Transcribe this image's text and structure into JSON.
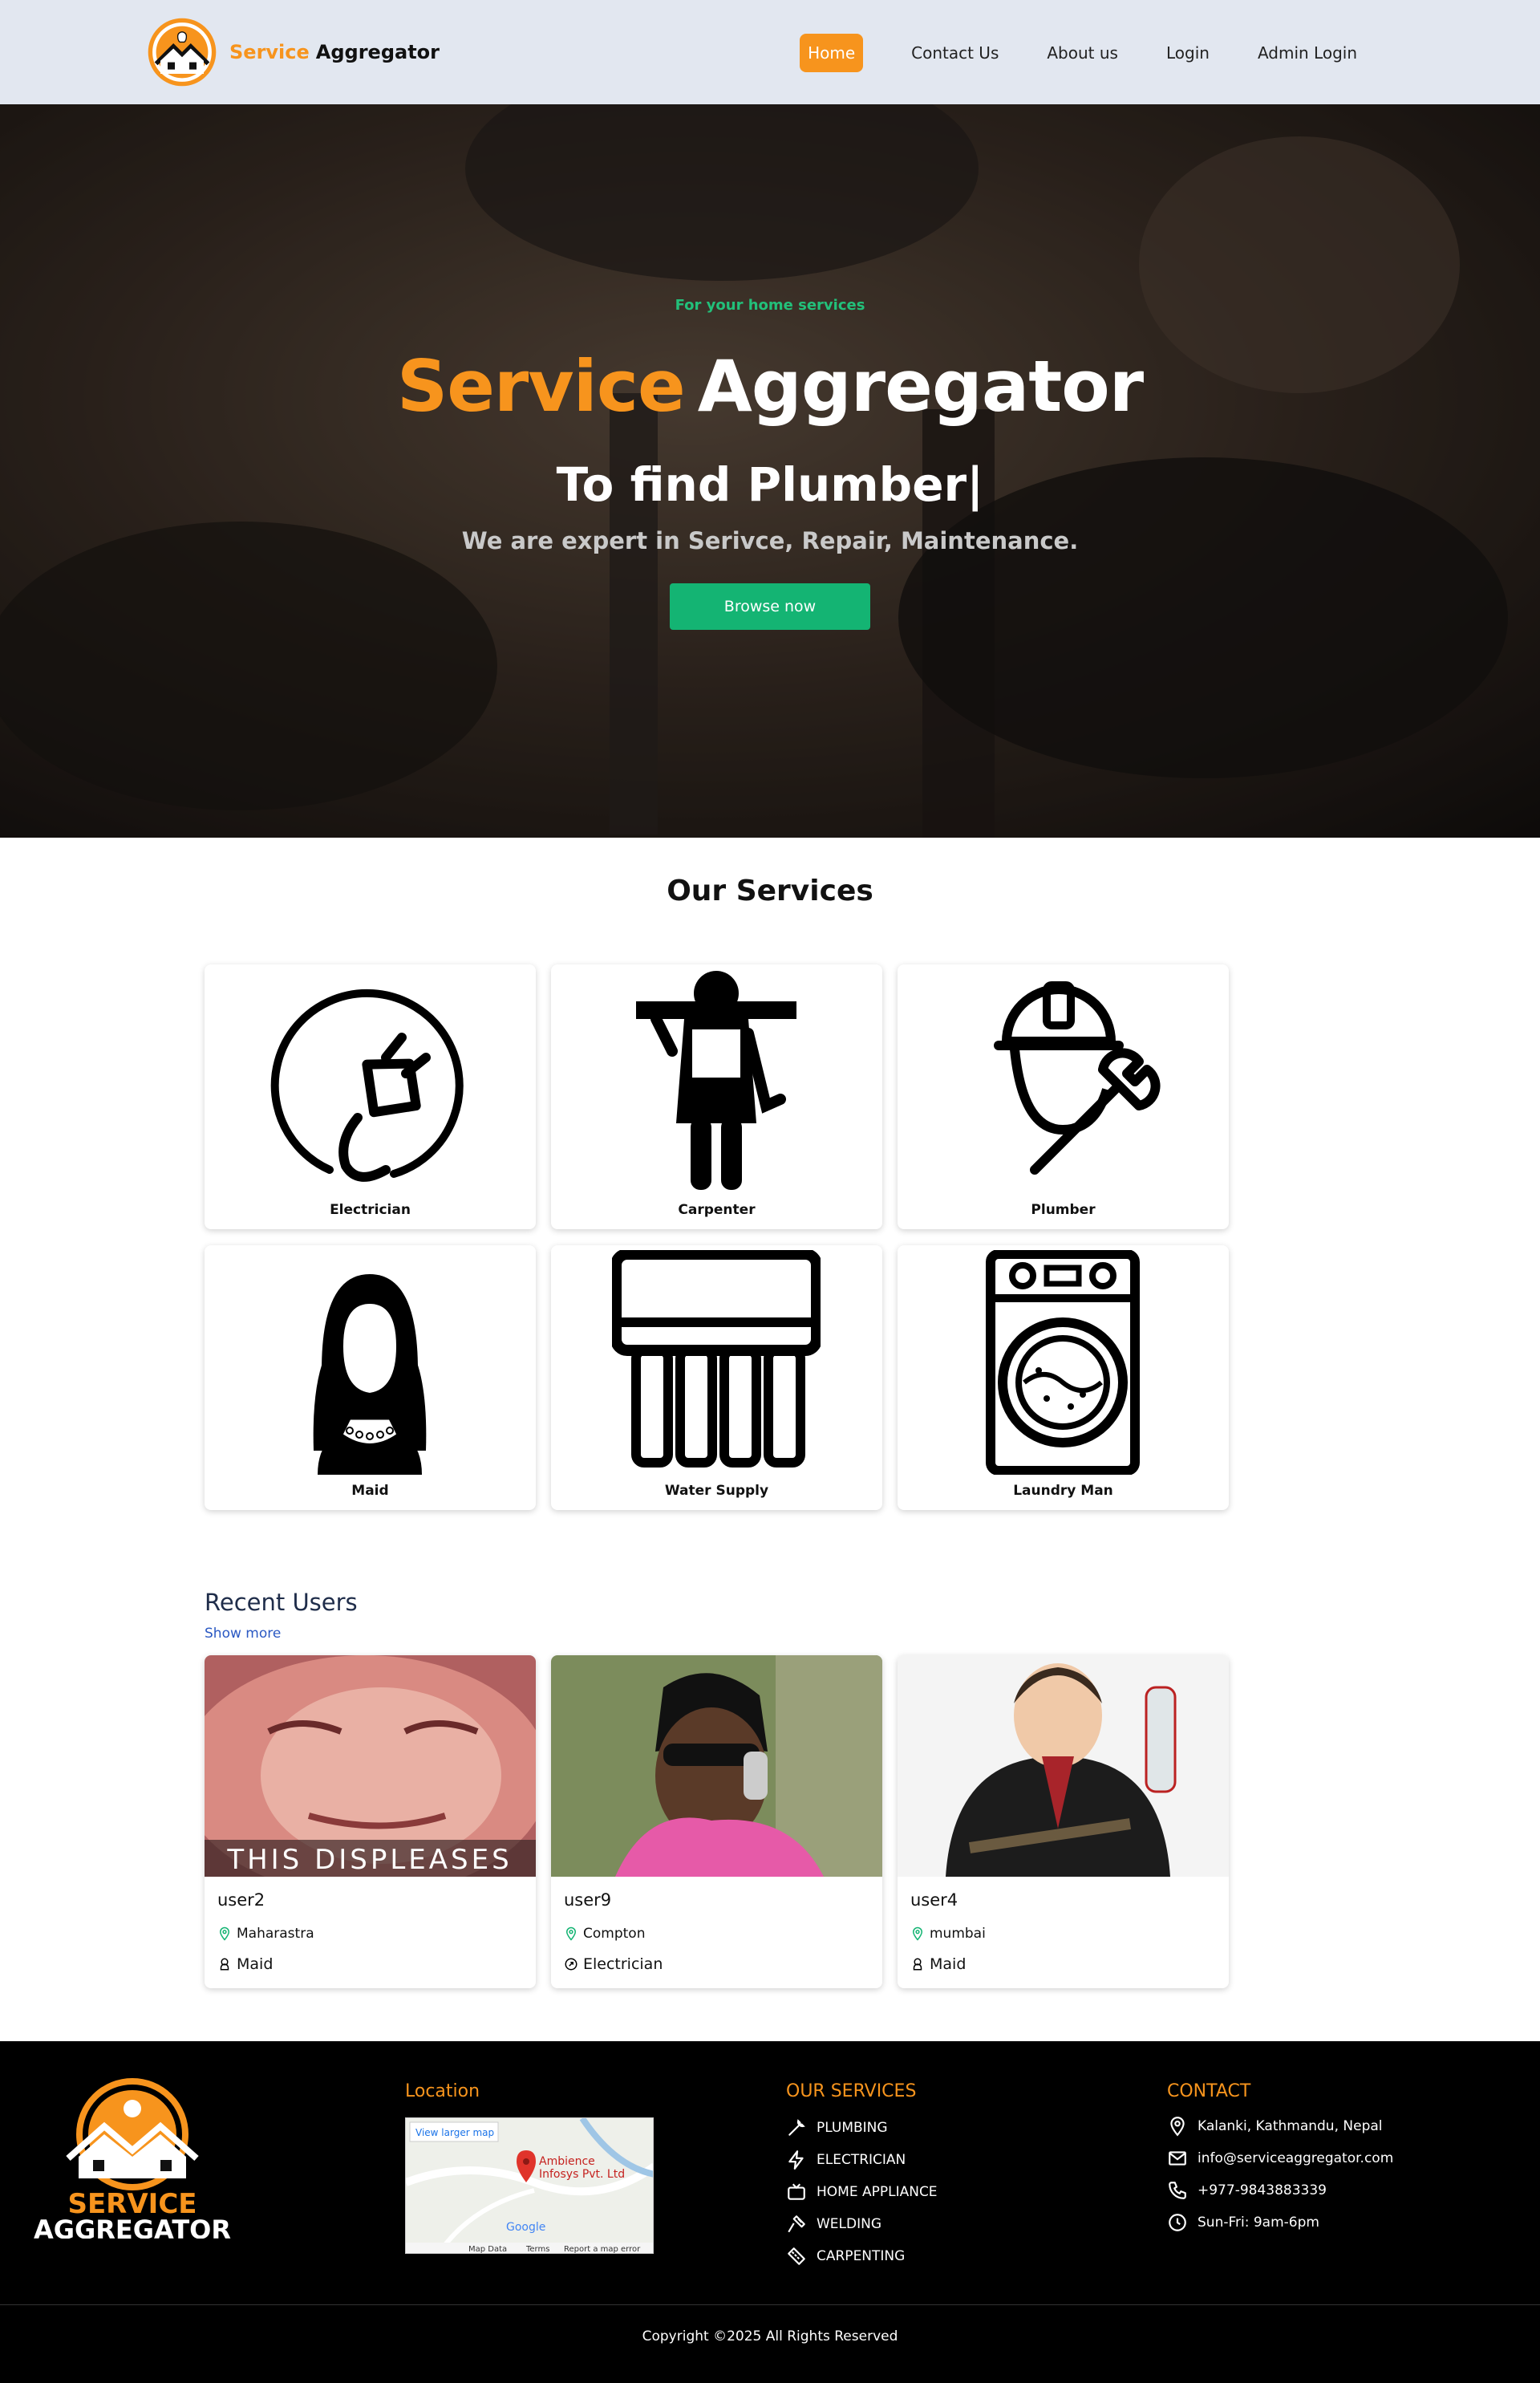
{
  "brand": {
    "name_accent": "Service",
    "name_rest": "Aggregator"
  },
  "nav": {
    "items": [
      {
        "label": "Home",
        "active": true
      },
      {
        "label": "Contact Us"
      },
      {
        "label": "About us"
      },
      {
        "label": "Login"
      },
      {
        "label": "Admin Login"
      }
    ]
  },
  "hero": {
    "tagline": "For your home services",
    "title_accent": "Service",
    "title_rest": "Aggregator",
    "subtitle": "To find Plumber|",
    "description": "We are expert in Serivce, Repair, Maintenance.",
    "button": "Browse now"
  },
  "services": {
    "title": "Our Services",
    "items": [
      {
        "label": "Electrician",
        "icon": "plug-icon"
      },
      {
        "label": "Carpenter",
        "icon": "carpenter-icon"
      },
      {
        "label": "Plumber",
        "icon": "plumber-icon"
      },
      {
        "label": "Maid",
        "icon": "maid-icon"
      },
      {
        "label": "Water Supply",
        "icon": "water-supply-icon"
      },
      {
        "label": "Laundry Man",
        "icon": "washing-machine-icon"
      }
    ]
  },
  "recent_users": {
    "title": "Recent Users",
    "show_more": "Show more",
    "users": [
      {
        "name": "user2",
        "location": "Maharastra",
        "role": "Maid",
        "image_caption": "THIS DISPLEASES"
      },
      {
        "name": "user9",
        "location": "Compton",
        "role": "Electrician"
      },
      {
        "name": "user4",
        "location": "mumbai",
        "role": "Maid"
      }
    ]
  },
  "footer": {
    "logo_line1": "SERVICE",
    "logo_line2": "AGGREGATOR",
    "location_title": "Location",
    "map": {
      "link": "View larger map",
      "place_line1": "Ambience",
      "place_line2": "Infosys Pvt. Ltd",
      "attribution": "Map Data",
      "terms": "Terms",
      "report": "Report a map error",
      "google": "Google"
    },
    "services_title": "OUR SERVICES",
    "services": [
      "PLUMBING",
      "ELECTRICIAN",
      "HOME APPLIANCE",
      "WELDING",
      "CARPENTING"
    ],
    "contact_title": "CONTACT",
    "contact": [
      "Kalanki, Kathmandu, Nepal",
      "info@serviceaggregator.com",
      "+977-9843883339",
      "Sun-Fri: 9am-6pm"
    ],
    "copyright": "Copyright ©2025 All Rights Reserved"
  },
  "colors": {
    "accent": "#f7941d",
    "green": "#14b473",
    "nav_bg": "#e2e7f0",
    "footer_bg": "#000000"
  }
}
